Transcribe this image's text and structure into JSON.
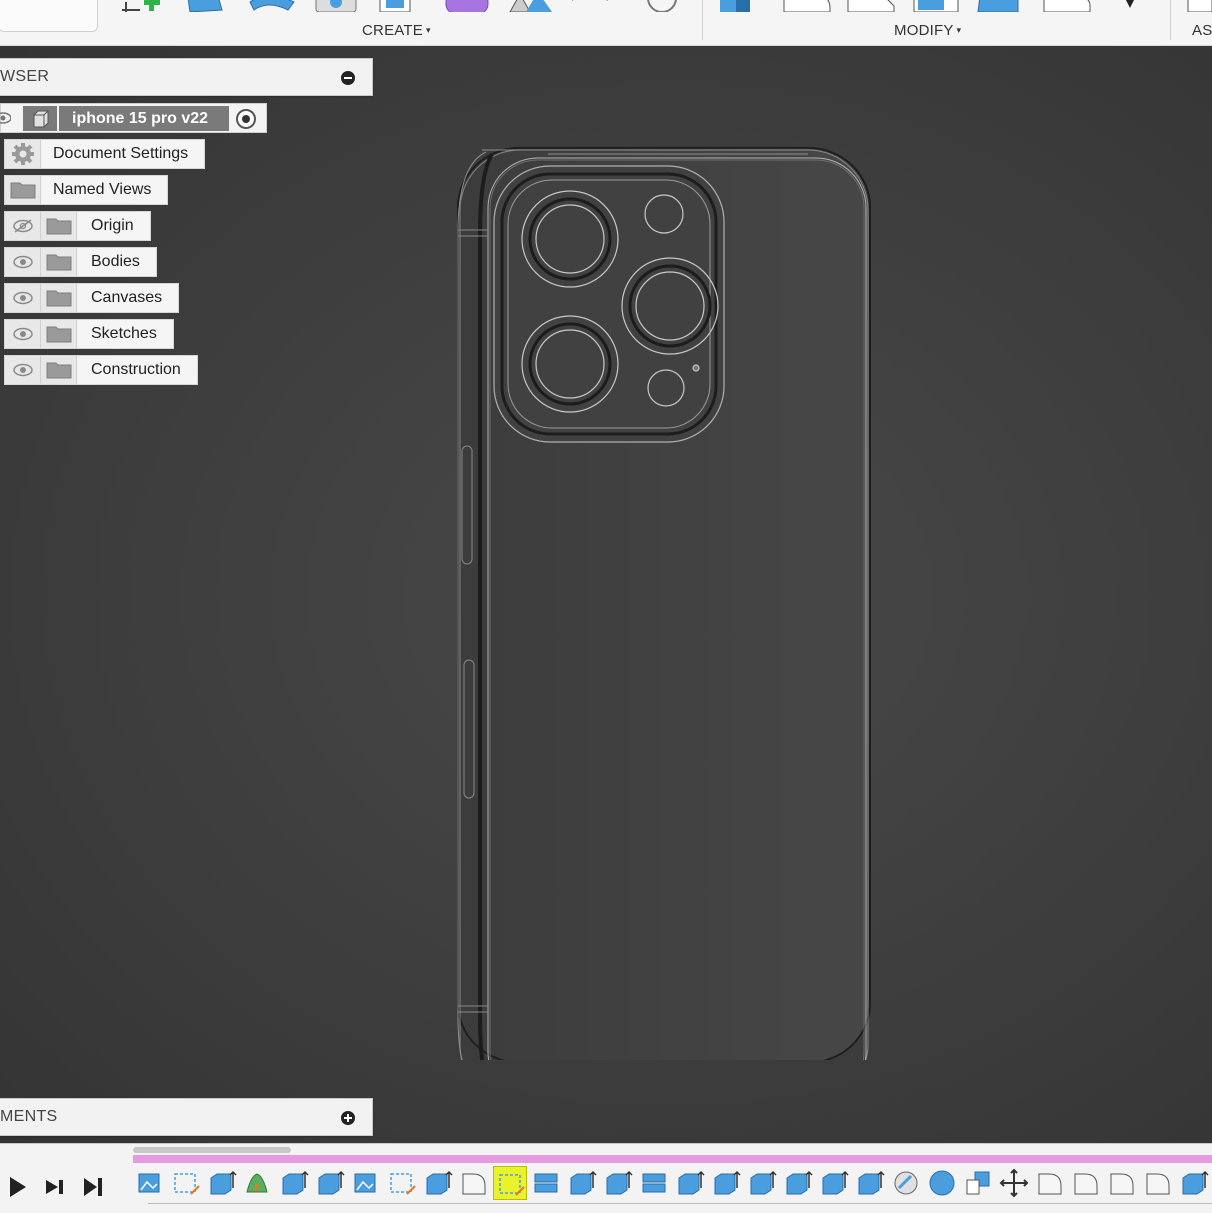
{
  "toolbar": {
    "create_label": "CREATE",
    "modify_label": "MODIFY",
    "assemble_label": "AS",
    "caret": "▾"
  },
  "browser": {
    "title": "WSER",
    "root": {
      "name": "iphone 15 pro v22"
    },
    "items": [
      {
        "label": "Document Settings",
        "icon": "gear-icon",
        "visibility": "none"
      },
      {
        "label": "Named Views",
        "icon": "folder-icon",
        "visibility": "none"
      },
      {
        "label": "Origin",
        "icon": "folder-icon",
        "visibility": "hidden"
      },
      {
        "label": "Bodies",
        "icon": "folder-icon",
        "visibility": "visible"
      },
      {
        "label": "Canvases",
        "icon": "folder-icon",
        "visibility": "visible"
      },
      {
        "label": "Sketches",
        "icon": "folder-icon",
        "visibility": "visible"
      },
      {
        "label": "Construction",
        "icon": "folder-icon",
        "visibility": "visible"
      }
    ]
  },
  "comments": {
    "title": "MENTS"
  },
  "timeline": {
    "controls": [
      "play-icon",
      "step-forward-icon",
      "skip-to-end-icon"
    ],
    "features": [
      "canvas",
      "sketch",
      "extrude",
      "loft",
      "extrude",
      "extrude",
      "canvas",
      "sketch",
      "extrude",
      "fillet",
      "sketch",
      "split",
      "extrude",
      "extrude",
      "split",
      "extrude",
      "extrude",
      "extrude",
      "extrude",
      "extrude",
      "extrude",
      "shell",
      "sphere",
      "scale",
      "move",
      "fillet",
      "fillet",
      "fillet",
      "fillet",
      "extrude"
    ],
    "active_index": 10
  },
  "colors": {
    "accent_blue": "#4a9ede",
    "timeline_bar": "#e69be0",
    "active_feature": "#e9f22a"
  }
}
